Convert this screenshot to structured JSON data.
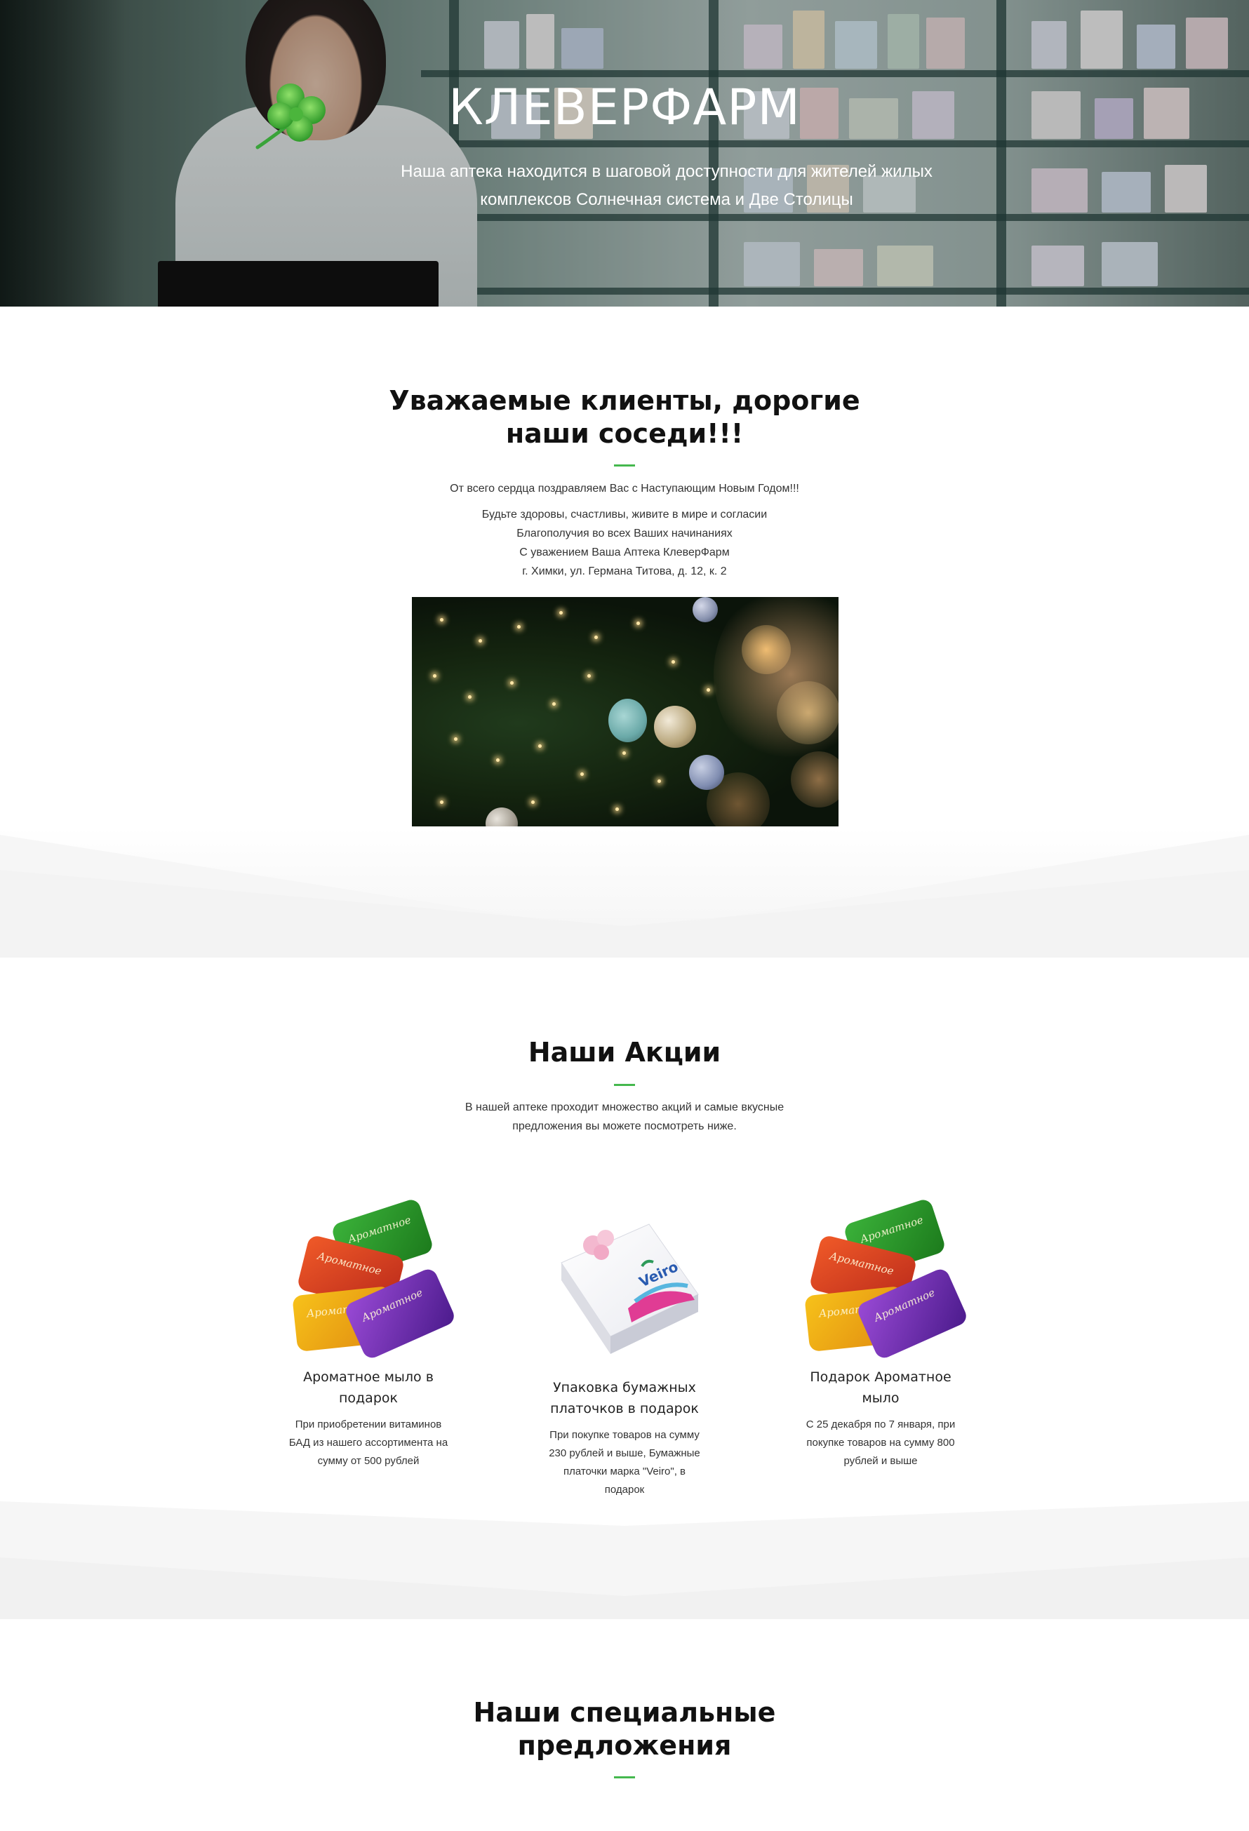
{
  "hero": {
    "title": "КЛЕВЕРФАРМ",
    "subtitle_line1": "Наша аптека находится в шаговой доступности для жителей жилых",
    "subtitle_line2": "комплексов Солнечная система и Две Столицы"
  },
  "greeting": {
    "title_line1": "Уважаемые клиенты, дорогие",
    "title_line2": "наши соседи!!!",
    "line1": "От всего сердца поздравляем Вас с Наступающим Новым Годом!!!",
    "line2": "Будьте здоровы, счастливы, живите в мире и согласии",
    "line3": "Благополучия во всех Ваших начинаниях",
    "line4": "С уважением Ваша Аптека КлеверФарм",
    "line5": "г. Химки, ул. Германа Титова, д. 12, к. 2"
  },
  "promos": {
    "title": "Наши Акции",
    "intro_line1": "В нашей аптеке проходит множество акций  и самые вкусные",
    "intro_line2": "предложения вы можете посмотреть ниже.",
    "items": [
      {
        "title_line1": "Ароматное мыло в",
        "title_line2": "подарок",
        "desc": [
          "При приобретении витаминов",
          "БАД из нашего ассортимента на",
          "сумму от 500 рублей"
        ]
      },
      {
        "title_line1": "Упаковка бумажных",
        "title_line2": "платочков в подарок",
        "desc": [
          "При покупке товаров на сумму",
          "230 рублей и выше, Бумажные",
          "платочки марка \"Veiro\", в",
          "подарок"
        ],
        "brand": "Veiro"
      },
      {
        "title_line1": "Подарок Ароматное",
        "title_line2": "мыло",
        "desc": [
          "С 25 декабря по 7 января, при",
          "покупке товаров на сумму 800",
          "рублей и выше"
        ]
      }
    ]
  },
  "specials": {
    "title_line1": "Наши специальные",
    "title_line2": "предложения"
  },
  "colors": {
    "accent": "#45b84e",
    "band": "#f4f4f4"
  },
  "icons": {
    "logo": "clover-icon"
  }
}
